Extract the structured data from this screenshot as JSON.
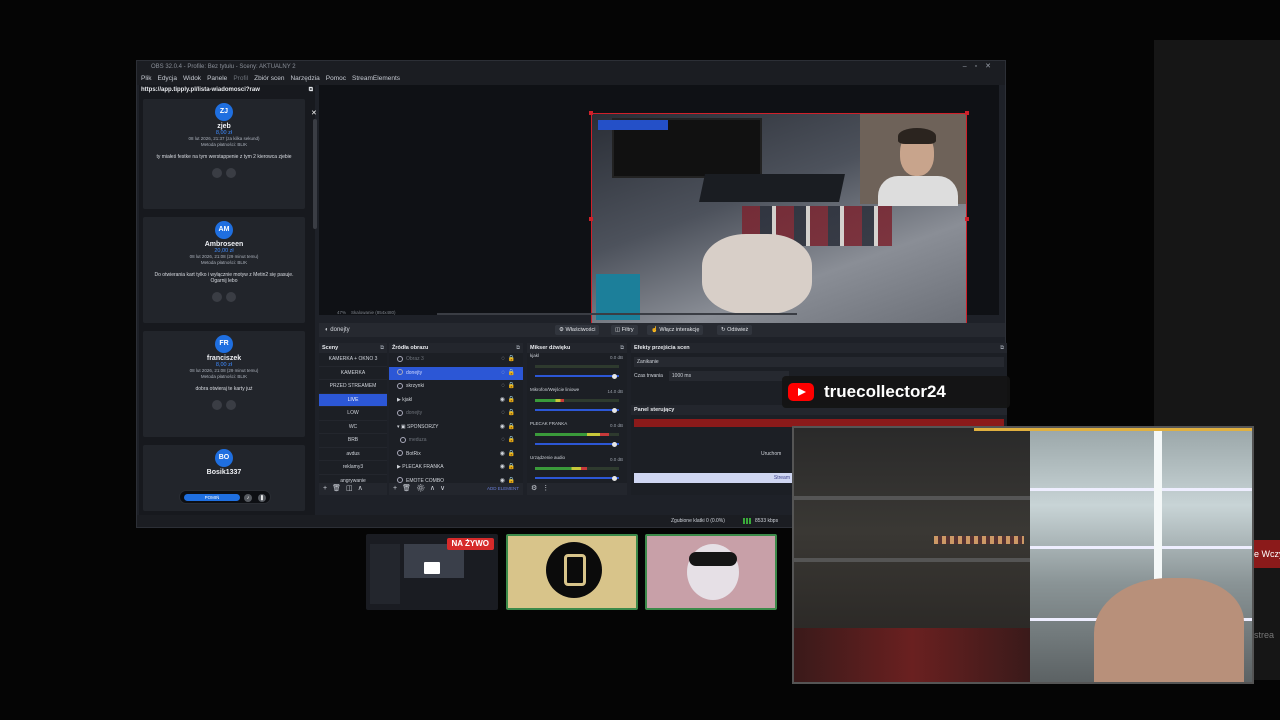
{
  "obs": {
    "window_title": "OBS 32.0.4 - Profile: Bez tytułu - Sceny: AKTUALNY 2",
    "menu": [
      "Plik",
      "Edycja",
      "Widok",
      "Panele",
      "Profil",
      "Zbiór scen",
      "Narzędzia",
      "Pomoc",
      "StreamElements"
    ],
    "browser_dock": {
      "url": "https://app.tipply.pl/lista-wiadomosci?raw",
      "donations": [
        {
          "initials": "ZJ",
          "name": "zjeb",
          "amount": "8,00 zł",
          "date": "08 lut 2026, 21:37 (za kilka sekund)",
          "method": "Metoda płatności: BLIK",
          "message": "ty miałeś festke na tym werstappenie z tym 2 kierowca zjebie"
        },
        {
          "initials": "AM",
          "name": "Ambroseen",
          "amount": "20,00 zł",
          "date": "08 lut 2026, 21:08 (29 minut temu)",
          "method": "Metoda płatności: BLIK",
          "message": "Do otwierania kart tylko i wyłącznie motyw z Metin2 się pasuje. Ogarnij lebo"
        },
        {
          "initials": "FR",
          "name": "franciszek",
          "amount": "8,00 zł",
          "date": "08 lut 2026, 21:08 (29 minut temu)",
          "method": "Metoda płatności: BLIK",
          "message": "dobra otwieraj te karty już"
        },
        {
          "initials": "BO",
          "name": "Bosik1337",
          "amount": "",
          "date": "",
          "method": "",
          "message": ""
        }
      ],
      "pill_button": "POMIŃ"
    },
    "preview": {
      "zoom": "47%",
      "scaling": "Skalowanie (854x480)"
    },
    "context_bar": {
      "source": "donejty",
      "buttons": [
        "Właściwości",
        "Filtry",
        "Włącz interakcję",
        "Odśwież"
      ]
    },
    "scenes": {
      "header": "Sceny",
      "items": [
        "KAMERKA + OKNO 3",
        "KAMERKA",
        "PRZED STREAMEM",
        "LIVE",
        "LOW",
        "WC",
        "BRB",
        "avdus",
        "reklamy3",
        "angrywanie"
      ],
      "active_index": 3
    },
    "sources": {
      "header": "Źródła obrazu",
      "items": [
        {
          "label": "Obraz 3",
          "dim": true,
          "selected": false
        },
        {
          "label": "donejty",
          "dim": false,
          "selected": true
        },
        {
          "label": "skrzynki",
          "dim": false,
          "selected": false
        },
        {
          "label": "kjakl",
          "dim": false,
          "selected": false
        },
        {
          "label": "donejty",
          "dim": true,
          "selected": false
        },
        {
          "label": "SPONSORZY",
          "dim": false,
          "selected": false
        },
        {
          "label": "meduza",
          "dim": true,
          "selected": false
        },
        {
          "label": "BotRix",
          "dim": false,
          "selected": false
        },
        {
          "label": "PLECAK FRANKA",
          "dim": false,
          "selected": false
        },
        {
          "label": "EMOTE COMBO",
          "dim": false,
          "selected": false
        }
      ],
      "add_element": "ADD ELEMENT"
    },
    "mixer": {
      "header": "Mikser dźwięku",
      "channels": [
        {
          "name": "kjakl",
          "db": "0.0 dB",
          "level": 0
        },
        {
          "name": "Mikrofon/Wejście liniowe",
          "db": "14.0 dB",
          "level": 35
        },
        {
          "name": "PLECAK FRANKA",
          "db": "0.0 dB",
          "level": 88
        },
        {
          "name": "Urządzenie audio",
          "db": "0.0 dB",
          "level": 62
        }
      ]
    },
    "transitions": {
      "header": "Efekty przejścia scen",
      "selected": "Zanikanie",
      "duration_label": "Czas trwania",
      "duration": "1000 ms"
    },
    "control_panel": {
      "header": "Panel sterujący",
      "start_label": "Uruchom",
      "stream_label": "Stream"
    },
    "status": {
      "dropped": "Zgubione klatki 0 (0.0%)",
      "bitrate": "8533 kbps"
    }
  },
  "thumbs": {
    "live_badge": "NA ŻYWO"
  },
  "youtube_overlay": {
    "channel": "truecollector24"
  },
  "side": {
    "red_text": "e Wczy",
    "gray_text": "strea"
  }
}
